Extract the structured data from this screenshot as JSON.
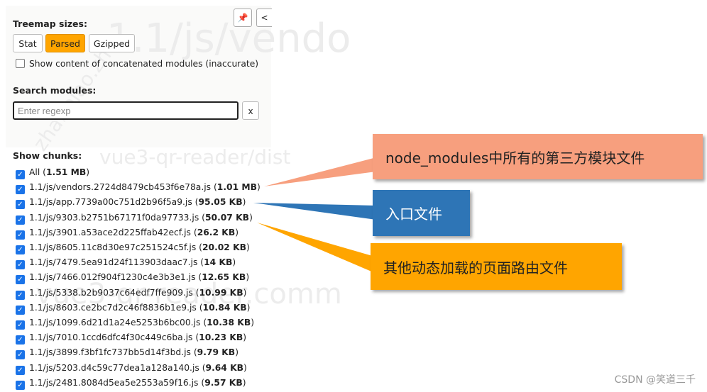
{
  "watermarks": [
    "1.1/js/vendo",
    "vue3-qr-reader/dist",
    "vue3-qr-reader.comm",
    "zhanbiao.zh"
  ],
  "toolbar": {
    "pin_icon": "pin-icon",
    "collapse_icon": "chevron-left-icon"
  },
  "treemap": {
    "title": "Treemap sizes:",
    "buttons": [
      {
        "label": "Stat"
      },
      {
        "label": "Parsed",
        "active": true
      },
      {
        "label": "Gzipped"
      }
    ],
    "concat_label": "Show content of concatenated modules (inaccurate)",
    "concat_checked": false
  },
  "search": {
    "title": "Search modules:",
    "placeholder": "Enter regexp",
    "value": "",
    "clear_label": "x"
  },
  "chunks": {
    "title": "Show chunks:",
    "items": [
      {
        "name": "All",
        "size": "1.51 MB"
      },
      {
        "name": "1.1/js/vendors.2724d8479cb453f6e78a.js",
        "size": "1.01 MB"
      },
      {
        "name": "1.1/js/app.7739a00c751d2b96f5a9.js",
        "size": "95.05 KB"
      },
      {
        "name": "1.1/js/9303.b2751b67171f0da97733.js",
        "size": "50.07 KB"
      },
      {
        "name": "1.1/js/3901.a53ace2d225ffab42ecf.js",
        "size": "26.2 KB"
      },
      {
        "name": "1.1/js/8605.11c8d30e97c251524c5f.js",
        "size": "20.02 KB"
      },
      {
        "name": "1.1/js/7479.5ea91d24f113903daac7.js",
        "size": "14 KB"
      },
      {
        "name": "1.1/js/7466.012f904f1230c4e3b3e1.js",
        "size": "12.65 KB"
      },
      {
        "name": "1.1/js/5338.b2b9037c64edf7ffe909.js",
        "size": "10.99 KB"
      },
      {
        "name": "1.1/js/8603.ce2bc7d2c46f8836b1e9.js",
        "size": "10.84 KB"
      },
      {
        "name": "1.1/js/1099.6d21d1a24e5253b6bc00.js",
        "size": "10.38 KB"
      },
      {
        "name": "1.1/js/7010.1ccd6dfc4f30c449c6ba.js",
        "size": "10.23 KB"
      },
      {
        "name": "1.1/js/3899.f3bf1fc737bb5d14f3bd.js",
        "size": "9.79 KB"
      },
      {
        "name": "1.1/js/5203.d4c59c77dea1a128a140.js",
        "size": "9.64 KB"
      },
      {
        "name": "1.1/js/2481.8084d5ea5e2553a59f16.js",
        "size": "9.57 KB"
      }
    ]
  },
  "callouts": [
    {
      "text": "node_modules中所有的第三方模块文件",
      "color": "#f79f7e"
    },
    {
      "text": "入口文件",
      "color": "#2e75b6"
    },
    {
      "text": "其他动态加载的页面路由文件",
      "color": "#ffa500"
    }
  ],
  "credit": "CSDN @笑道三千"
}
